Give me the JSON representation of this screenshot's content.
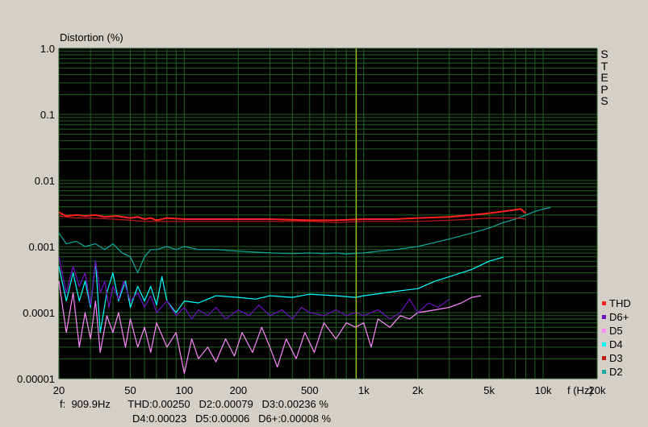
{
  "chart_data": {
    "type": "line",
    "ylabel": "Distortion (%)",
    "xlabel": "f (Hz)",
    "xscale": "log",
    "yscale": "log",
    "xlim": [
      20,
      20000
    ],
    "ylim": [
      1e-05,
      1.0
    ],
    "y_tick_labels": [
      "1.0",
      "0.1",
      "0.01",
      "0.001",
      "0.0001",
      "0.00001"
    ],
    "y_tick_values": [
      1.0,
      0.1,
      0.01,
      0.001,
      0.0001,
      1e-05
    ],
    "x_tick_labels": [
      "20",
      "50",
      "100",
      "200",
      "500",
      "1k",
      "2k",
      "5k",
      "10k",
      "20k"
    ],
    "x_tick_values": [
      20,
      50,
      100,
      200,
      500,
      1000,
      2000,
      5000,
      10000,
      20000
    ],
    "grid": true,
    "cursor_frequency": 909.9,
    "side_text": [
      "S",
      "T",
      "E",
      "P",
      "S"
    ],
    "series": [
      {
        "name": "THD",
        "color": "#ff2020",
        "width": 2,
        "points": [
          [
            20,
            0.0033
          ],
          [
            22,
            0.0029
          ],
          [
            25,
            0.003
          ],
          [
            28,
            0.0029
          ],
          [
            32,
            0.003
          ],
          [
            36,
            0.0028
          ],
          [
            42,
            0.0029
          ],
          [
            50,
            0.0027
          ],
          [
            55,
            0.0028
          ],
          [
            60,
            0.0026
          ],
          [
            65,
            0.0027
          ],
          [
            70,
            0.0025
          ],
          [
            80,
            0.0027
          ],
          [
            100,
            0.0026
          ],
          [
            150,
            0.0026
          ],
          [
            200,
            0.0026
          ],
          [
            300,
            0.0026
          ],
          [
            500,
            0.0025
          ],
          [
            700,
            0.0025
          ],
          [
            1000,
            0.0026
          ],
          [
            1500,
            0.0026
          ],
          [
            2000,
            0.0027
          ],
          [
            3000,
            0.0028
          ],
          [
            4000,
            0.003
          ],
          [
            5000,
            0.0032
          ],
          [
            6000,
            0.0034
          ],
          [
            7000,
            0.0036
          ],
          [
            7500,
            0.0037
          ],
          [
            8000,
            0.0032
          ]
        ]
      },
      {
        "name": "D6+",
        "color": "#7010c0",
        "width": 1.2,
        "points": [
          [
            20,
            0.0007
          ],
          [
            22,
            0.0002
          ],
          [
            24,
            0.0005
          ],
          [
            26,
            0.00025
          ],
          [
            28,
            0.0004
          ],
          [
            30,
            0.00013
          ],
          [
            32,
            0.0006
          ],
          [
            34,
            0.0002
          ],
          [
            36,
            0.0003
          ],
          [
            38,
            0.00012
          ],
          [
            40,
            0.00025
          ],
          [
            43,
            0.00016
          ],
          [
            46,
            0.0003
          ],
          [
            50,
            0.00015
          ],
          [
            55,
            0.0002
          ],
          [
            60,
            0.00012
          ],
          [
            65,
            0.00018
          ],
          [
            70,
            0.0001
          ],
          [
            80,
            0.00015
          ],
          [
            90,
            9e-05
          ],
          [
            100,
            0.00012
          ],
          [
            110,
            8e-05
          ],
          [
            120,
            0.00011
          ],
          [
            135,
            9e-05
          ],
          [
            150,
            0.00012
          ],
          [
            170,
            8e-05
          ],
          [
            200,
            0.00011
          ],
          [
            230,
            9e-05
          ],
          [
            260,
            0.00013
          ],
          [
            300,
            9e-05
          ],
          [
            350,
            0.00011
          ],
          [
            400,
            8e-05
          ],
          [
            450,
            0.00012
          ],
          [
            500,
            0.0001
          ],
          [
            600,
            9e-05
          ],
          [
            700,
            0.00011
          ],
          [
            800,
            9e-05
          ],
          [
            900,
            0.0001
          ],
          [
            1000,
            9e-05
          ],
          [
            1200,
            0.00011
          ],
          [
            1400,
            8e-05
          ],
          [
            1600,
            0.0001
          ],
          [
            1800,
            0.00016
          ],
          [
            2000,
            0.0001
          ],
          [
            2300,
            0.00014
          ],
          [
            2600,
            0.00012
          ],
          [
            3000,
            0.00016
          ]
        ]
      },
      {
        "name": "D5",
        "color": "#ff88ff",
        "width": 1.2,
        "points": [
          [
            20,
            0.0003
          ],
          [
            22,
            5e-05
          ],
          [
            24,
            0.0002
          ],
          [
            26,
            3e-05
          ],
          [
            28,
            0.0001
          ],
          [
            30,
            4e-05
          ],
          [
            32,
            0.00015
          ],
          [
            34,
            2.5e-05
          ],
          [
            37,
            9e-05
          ],
          [
            40,
            5e-05
          ],
          [
            43,
            0.0001
          ],
          [
            47,
            3e-05
          ],
          [
            50,
            8e-05
          ],
          [
            55,
            3e-05
          ],
          [
            60,
            6e-05
          ],
          [
            65,
            2.5e-05
          ],
          [
            70,
            7e-05
          ],
          [
            80,
            3e-05
          ],
          [
            90,
            5e-05
          ],
          [
            100,
            1.2e-05
          ],
          [
            110,
            4e-05
          ],
          [
            120,
            2e-05
          ],
          [
            135,
            3e-05
          ],
          [
            150,
            1.8e-05
          ],
          [
            170,
            4e-05
          ],
          [
            190,
            2.2e-05
          ],
          [
            210,
            5e-05
          ],
          [
            240,
            2.5e-05
          ],
          [
            270,
            6e-05
          ],
          [
            300,
            3e-05
          ],
          [
            330,
            1.5e-05
          ],
          [
            370,
            4e-05
          ],
          [
            420,
            2e-05
          ],
          [
            470,
            5e-05
          ],
          [
            530,
            2.5e-05
          ],
          [
            600,
            7e-05
          ],
          [
            700,
            4e-05
          ],
          [
            800,
            7e-05
          ],
          [
            900,
            6e-05
          ],
          [
            1000,
            7e-05
          ],
          [
            1100,
            3e-05
          ],
          [
            1200,
            8e-05
          ],
          [
            1400,
            6e-05
          ],
          [
            1600,
            9e-05
          ],
          [
            1800,
            8e-05
          ],
          [
            2000,
            0.0001
          ],
          [
            2500,
            0.00011
          ],
          [
            3000,
            0.00012
          ],
          [
            3500,
            0.00014
          ],
          [
            4000,
            0.00017
          ],
          [
            4500,
            0.00018
          ]
        ]
      },
      {
        "name": "D4",
        "color": "#00ffff",
        "width": 1.2,
        "points": [
          [
            20,
            0.0005
          ],
          [
            22,
            0.00015
          ],
          [
            24,
            0.0004
          ],
          [
            26,
            0.00015
          ],
          [
            28,
            0.0003
          ],
          [
            30,
            0.00012
          ],
          [
            32,
            0.0006
          ],
          [
            34,
            5e-05
          ],
          [
            37,
            0.0002
          ],
          [
            40,
            0.0004
          ],
          [
            43,
            0.00015
          ],
          [
            47,
            0.0003
          ],
          [
            50,
            0.00012
          ],
          [
            55,
            0.00025
          ],
          [
            60,
            0.00015
          ],
          [
            65,
            0.00025
          ],
          [
            70,
            0.00013
          ],
          [
            75,
            0.00035
          ],
          [
            80,
            0.00015
          ],
          [
            90,
            0.0001
          ],
          [
            100,
            0.00015
          ],
          [
            120,
            0.00014
          ],
          [
            150,
            0.00018
          ],
          [
            200,
            0.00017
          ],
          [
            250,
            0.00016
          ],
          [
            300,
            0.00018
          ],
          [
            400,
            0.00017
          ],
          [
            500,
            0.00019
          ],
          [
            700,
            0.00018
          ],
          [
            900,
            0.00017
          ],
          [
            1000,
            0.00018
          ],
          [
            1500,
            0.00021
          ],
          [
            2000,
            0.00023
          ],
          [
            2500,
            0.0003
          ],
          [
            3000,
            0.00035
          ],
          [
            4000,
            0.00045
          ],
          [
            5000,
            0.0006
          ],
          [
            6000,
            0.00069
          ]
        ]
      },
      {
        "name": "D3",
        "color": "#c01818",
        "width": 1.2,
        "points": [
          [
            20,
            0.0029
          ],
          [
            25,
            0.0027
          ],
          [
            30,
            0.0027
          ],
          [
            40,
            0.0026
          ],
          [
            50,
            0.0025
          ],
          [
            60,
            0.0024
          ],
          [
            70,
            0.0024
          ],
          [
            100,
            0.0024
          ],
          [
            200,
            0.0024
          ],
          [
            300,
            0.0024
          ],
          [
            500,
            0.0024
          ],
          [
            700,
            0.0023
          ],
          [
            1000,
            0.0024
          ],
          [
            2000,
            0.0024
          ],
          [
            3000,
            0.0025
          ],
          [
            4000,
            0.0026
          ],
          [
            5000,
            0.0027
          ],
          [
            6000,
            0.0027
          ],
          [
            7000,
            0.0027
          ],
          [
            8000,
            0.0026
          ]
        ]
      },
      {
        "name": "D2",
        "color": "#10a8a0",
        "width": 1.2,
        "points": [
          [
            20,
            0.0016
          ],
          [
            22,
            0.0011
          ],
          [
            25,
            0.0012
          ],
          [
            28,
            0.001
          ],
          [
            32,
            0.0011
          ],
          [
            36,
            0.0009
          ],
          [
            40,
            0.0011
          ],
          [
            45,
            0.0008
          ],
          [
            50,
            0.0007
          ],
          [
            55,
            0.0004
          ],
          [
            60,
            0.0007
          ],
          [
            65,
            0.0009
          ],
          [
            70,
            0.0009
          ],
          [
            80,
            0.001
          ],
          [
            90,
            0.0009
          ],
          [
            100,
            0.001
          ],
          [
            120,
            0.0009
          ],
          [
            150,
            0.0009
          ],
          [
            200,
            0.00085
          ],
          [
            300,
            0.0008
          ],
          [
            400,
            0.00078
          ],
          [
            500,
            0.0008
          ],
          [
            600,
            0.00078
          ],
          [
            700,
            0.0008
          ],
          [
            800,
            0.00077
          ],
          [
            909.9,
            0.00079
          ],
          [
            1000,
            0.0008
          ],
          [
            1200,
            0.00085
          ],
          [
            1500,
            0.0009
          ],
          [
            2000,
            0.001
          ],
          [
            3000,
            0.0013
          ],
          [
            4000,
            0.0016
          ],
          [
            5000,
            0.0019
          ],
          [
            6000,
            0.0023
          ],
          [
            7000,
            0.0026
          ],
          [
            8000,
            0.003
          ],
          [
            9000,
            0.0034
          ],
          [
            10000,
            0.0037
          ],
          [
            11000,
            0.0039
          ]
        ]
      }
    ]
  },
  "readout": {
    "line1": "f:  909.9Hz      THD:0.00250   D2:0.00079   D3:0.00236 %",
    "line2": "D4:0.00023   D5:0.00006   D6+:0.00008 %"
  },
  "colors": {
    "background": "#d4d0c8",
    "plot_bg": "#000000",
    "grid": "#206020",
    "cursor": "#c8c820"
  }
}
